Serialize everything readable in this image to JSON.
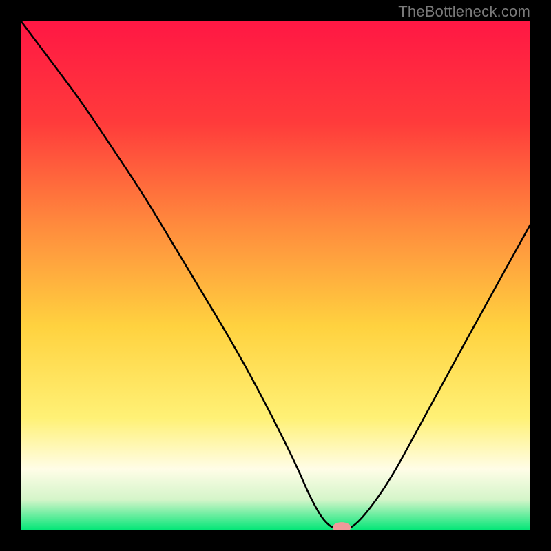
{
  "watermark": "TheBottleneck.com",
  "chart_data": {
    "type": "line",
    "title": "",
    "xlabel": "",
    "ylabel": "",
    "xlim": [
      0,
      100
    ],
    "ylim": [
      0,
      100
    ],
    "series": [
      {
        "name": "bottleneck-curve",
        "x": [
          0,
          6,
          12,
          18,
          24,
          30,
          36,
          42,
          48,
          54,
          57,
          60,
          63,
          66,
          72,
          78,
          84,
          90,
          100
        ],
        "values": [
          100,
          92,
          84,
          75,
          66,
          56,
          46,
          36,
          25,
          13,
          6,
          1,
          0,
          1,
          9,
          20,
          31,
          42,
          60
        ]
      }
    ],
    "annotations": [
      {
        "name": "minimum-marker",
        "x": 63,
        "y": 0
      }
    ],
    "gradient_stops": [
      {
        "pos": 0.0,
        "color": "#ff1744"
      },
      {
        "pos": 0.2,
        "color": "#ff3b3b"
      },
      {
        "pos": 0.4,
        "color": "#ff8a3d"
      },
      {
        "pos": 0.6,
        "color": "#ffd23f"
      },
      {
        "pos": 0.78,
        "color": "#fff176"
      },
      {
        "pos": 0.88,
        "color": "#fffde7"
      },
      {
        "pos": 0.94,
        "color": "#d4f5c9"
      },
      {
        "pos": 1.0,
        "color": "#00e676"
      }
    ]
  }
}
